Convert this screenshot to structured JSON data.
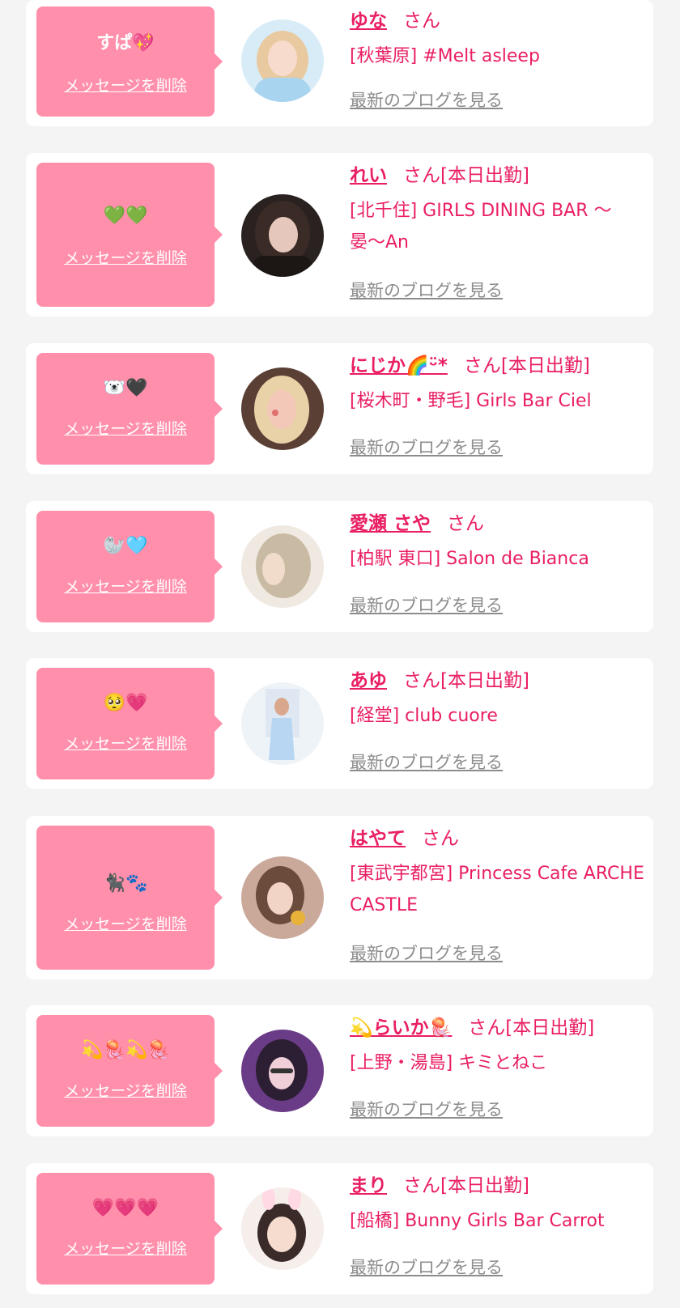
{
  "labels": {
    "delete": "メッセージを削除",
    "blog": "最新のブログを見る"
  },
  "colors": {
    "accent": "#e91e63",
    "bubble": "#ff8fab",
    "link_gray": "#8c8c8c",
    "page_bg": "#f4f4f4"
  },
  "entries": [
    {
      "message": "すぱ💖",
      "name": "ゆな",
      "suffix": "さん",
      "shop": "[秋葉原] #Melt asleep",
      "avatar_icon": "avatar-photo-icon"
    },
    {
      "message": "💚💚",
      "name": "れい",
      "suffix": "さん[本日出勤]",
      "shop": "[北千住] GIRLS DINING BAR 〜晏〜An",
      "avatar_icon": "avatar-photo-icon"
    },
    {
      "message": "🐻‍❄️🖤",
      "name": "にじか🌈ᵕ̈*",
      "suffix": "さん[本日出勤]",
      "shop": "[桜木町・野毛] Girls Bar Ciel",
      "avatar_icon": "avatar-photo-icon"
    },
    {
      "message": "🦭🩵",
      "name": "愛瀬 さや",
      "suffix": "さん",
      "shop": "[柏駅 東口] Salon de Bianca",
      "avatar_icon": "avatar-photo-icon"
    },
    {
      "message": "🥺💗",
      "name": "あゆ",
      "suffix": "さん[本日出勤]",
      "shop": "[経堂] club cuore",
      "avatar_icon": "avatar-photo-icon"
    },
    {
      "message": "🐈‍⬛🐾",
      "name": "はやて",
      "suffix": "さん",
      "shop": "[東武宇都宮] Princess Cafe ARCHE CASTLE",
      "avatar_icon": "avatar-photo-icon"
    },
    {
      "message": "💫🪼💫🪼",
      "name": "💫らいか🪼",
      "suffix": "さん[本日出勤]",
      "shop": "[上野・湯島] キミとねこ",
      "avatar_icon": "avatar-photo-icon"
    },
    {
      "message": "💗💗💗",
      "name": "まり",
      "suffix": "さん[本日出勤]",
      "shop": "[船橋] Bunny Girls Bar Carrot",
      "avatar_icon": "avatar-photo-icon"
    }
  ]
}
